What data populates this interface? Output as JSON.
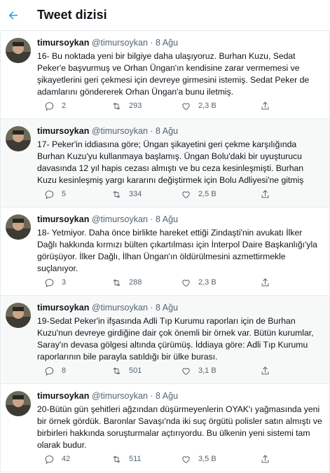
{
  "header": {
    "title": "Tweet dizisi",
    "back_icon": "arrow-left-icon"
  },
  "colors": {
    "accent": "#1d9bf0",
    "text": "#0f1419",
    "muted": "#536471",
    "border": "#e6ecf0"
  },
  "tweets": [
    {
      "name": "timursoykan",
      "handle": "@timursoykan",
      "dot": "·",
      "date": "8 Ağu",
      "text": "16- Bu noktada yeni bir bilgiye daha ulaşıyoruz. Burhan Kuzu, Sedat Peker'e başvurmuş ve Orhan Üngan'ın kendisine zarar vermemesi ve şikayetlerini geri çekmesi için devreye girmesini istemiş. Sedat Peker de adamlarını göndererek Orhan Üngan'a bunu iletmiş.",
      "replies": "2",
      "retweets": "293",
      "likes": "2,3 B"
    },
    {
      "name": "timursoykan",
      "handle": "@timursoykan",
      "dot": "·",
      "date": "8 Ağu",
      "text": "17- Peker'in iddiasına göre; Üngan şikayetini geri çekme karşılığında Burhan Kuzu'yu kullanmaya başlamış. Üngan Bolu'daki bir uyuşturucu davasında 12 yıl hapis cezası almıştı ve bu ceza kesinleşmişti. Burhan Kuzu kesinleşmiş yargı kararını değiştirmek için Bolu Adliyesi'ne gitmiş",
      "replies": "5",
      "retweets": "334",
      "likes": "2,5 B"
    },
    {
      "name": "timursoykan",
      "handle": "@timursoykan",
      "dot": "·",
      "date": "8 Ağu",
      "text": "18- Yetmiyor. Daha önce birlikte hareket ettiği Zindaşti'nin avukatı İlker Dağlı hakkında kırmızı bülten çıkartılması için İnterpol Daire Başkanlığı'yla görüşüyor. İlker Dağlı, İlhan Üngan'ın öldürülmesini azmettirmekle suçlanıyor.",
      "replies": "3",
      "retweets": "288",
      "likes": "2,3 B"
    },
    {
      "name": "timursoykan",
      "handle": "@timursoykan",
      "dot": "·",
      "date": "8 Ağu",
      "text": "19-Sedat Peker'in ifşasında Adli Tıp Kurumu raporları için de Burhan Kuzu'nun devreye girdiğine dair çok önemli bir örnek var. Bütün kurumlar, Saray'ın devasa gölgesi altında çürümüş. İddiaya göre: Adli Tıp Kurumu raporlarının bile parayla satıldığı bir ülke burası.",
      "replies": "8",
      "retweets": "501",
      "likes": "3,1 B"
    },
    {
      "name": "timursoykan",
      "handle": "@timursoykan",
      "dot": "·",
      "date": "8 Ağu",
      "text": "20-Bütün gün şehitleri ağzından düşürmeyenlerin OYAK'ı yağmasında yeni bir örnek gördük. Baronlar Savaşı'nda iki suç örgütü polisler satın almıştı ve birbirleri hakkında soruşturmalar açtırıyordu. Bu ülkenin yeni sistemi tam olarak budur.",
      "replies": "42",
      "retweets": "511",
      "likes": "3,5 B"
    }
  ]
}
